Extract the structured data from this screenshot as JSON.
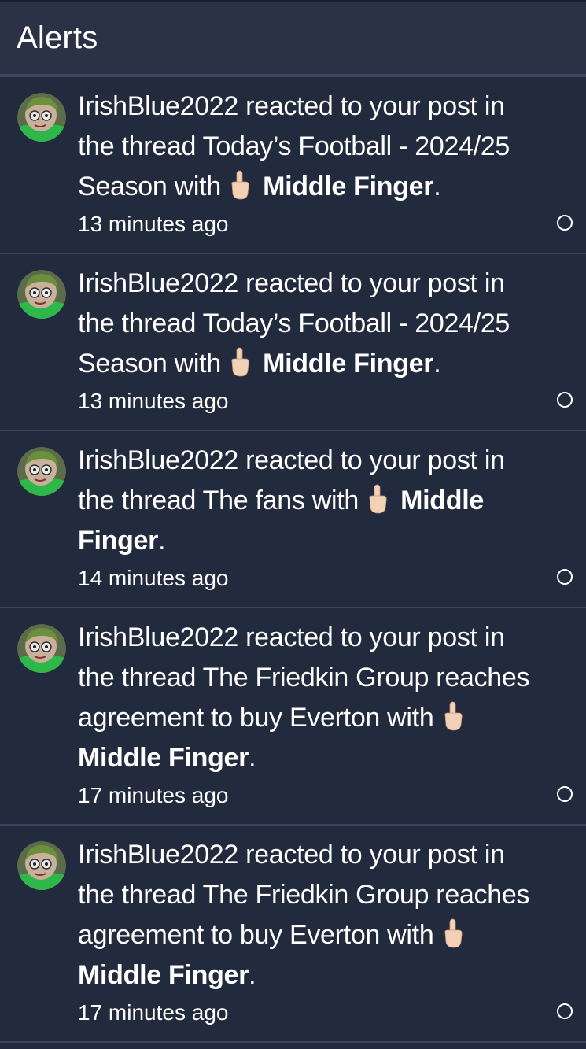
{
  "header": {
    "title": "Alerts"
  },
  "colors": {
    "background": "#222a3d",
    "header_bg": "#2b3245",
    "divider": "#3a4560",
    "text": "#ffffff"
  },
  "alerts": [
    {
      "text": "IrishBlue2022 reacted to your post in the thread Today’s Football - 2024/25 Season with",
      "reaction_icon": "middle-finger-emoji",
      "reaction": "Middle Finger",
      "suffix": ".",
      "time": "13 minutes ago",
      "status_icon": "read-marker-circle"
    },
    {
      "text": "IrishBlue2022 reacted to your post in the thread Today’s Football - 2024/25 Season with",
      "reaction_icon": "middle-finger-emoji",
      "reaction": "Middle Finger",
      "suffix": ".",
      "time": "13 minutes ago",
      "status_icon": "read-marker-circle"
    },
    {
      "text": "IrishBlue2022 reacted to your post in the thread The fans with",
      "reaction_icon": "middle-finger-emoji",
      "reaction": "Middle Finger",
      "suffix": ".",
      "time": "14 minutes ago",
      "status_icon": "read-marker-circle"
    },
    {
      "text": "IrishBlue2022 reacted to your post in the thread The Friedkin Group reaches agreement to buy Everton with",
      "reaction_icon": "middle-finger-emoji",
      "reaction": "Middle Finger",
      "suffix": ".",
      "time": "17 minutes ago",
      "status_icon": "read-marker-circle"
    },
    {
      "text": "IrishBlue2022 reacted to your post in the thread The Friedkin Group reaches agreement to buy Everton with",
      "reaction_icon": "middle-finger-emoji",
      "reaction": "Middle Finger",
      "suffix": ".",
      "time": "17 minutes ago",
      "status_icon": "read-marker-circle"
    }
  ]
}
